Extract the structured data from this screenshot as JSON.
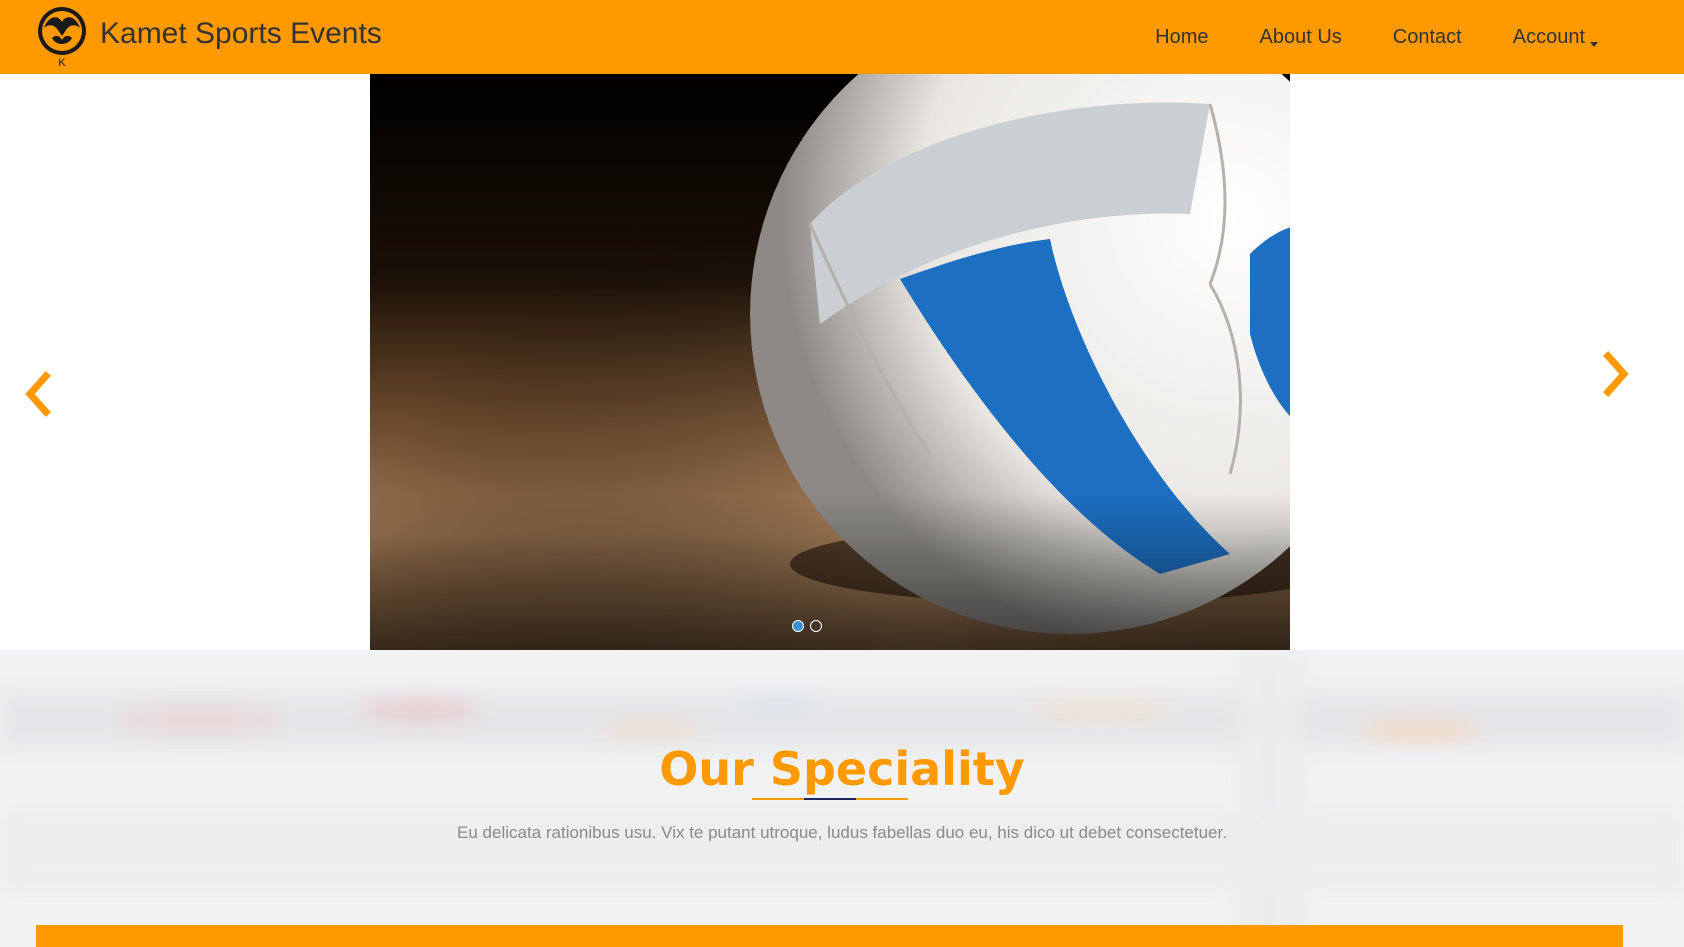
{
  "brand": {
    "name": "Kamet Sports Events",
    "logo_letter": "K"
  },
  "nav": {
    "items": [
      {
        "label": "Home"
      },
      {
        "label": "About Us"
      },
      {
        "label": "Contact"
      },
      {
        "label": "Account"
      }
    ]
  },
  "carousel": {
    "slide_count": 2,
    "active_index": 0,
    "image": "volleyball-on-court"
  },
  "speciality": {
    "title": "Our Speciality",
    "subtitle": "Eu delicata rationibus usu. Vix te putant utroque, ludus fabellas duo eu, his dico ut debet consectetuer."
  },
  "colors": {
    "accent": "#ff9900",
    "text": "#333333",
    "indicator_active": "#3a8fd6",
    "underline_mid": "#1d2a5a"
  }
}
